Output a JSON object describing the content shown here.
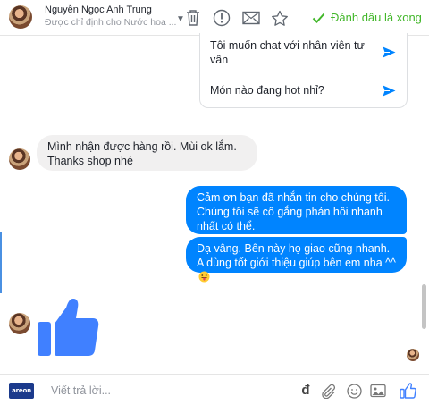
{
  "header": {
    "name": "Nguyễn Ngọc Anh Trung",
    "subtitle": "Được chỉ định cho Nước hoa ...",
    "done_label": "Đánh dấu là xong"
  },
  "suggestions": [
    {
      "text": "Tôi muốn chat với nhân viên tư vấn"
    },
    {
      "text": "Món nào đang hot nhỉ?"
    }
  ],
  "messages": {
    "incoming": "Mình nhận được hàng rồi. Mùi ok lắm. Thanks shop nhé",
    "outgoing_1": "Cảm ơn bạn đã nhắn tin cho chúng tôi. Chúng tôi sẽ cố gắng phản hồi nhanh nhất có thể.",
    "outgoing_2": "Dạ vâng. Bên này họ giao cũng nhanh. A dùng tốt giới thiệu giúp bên em nha ^^"
  },
  "composer": {
    "placeholder": "Viết trả lời...",
    "currency_symbol": "đ",
    "logo_text": "areon"
  },
  "icons": [
    "trash-icon",
    "exclamation-icon",
    "envelope-icon",
    "star-icon",
    "checkmark-icon",
    "send-icon",
    "like-icon",
    "attachment-icon",
    "emoji-icon",
    "image-icon"
  ],
  "colors": {
    "accent": "#0084ff",
    "done_green": "#42b72a",
    "incoming_bubble": "#f1f0f0",
    "like_blue": "#4080ff"
  }
}
